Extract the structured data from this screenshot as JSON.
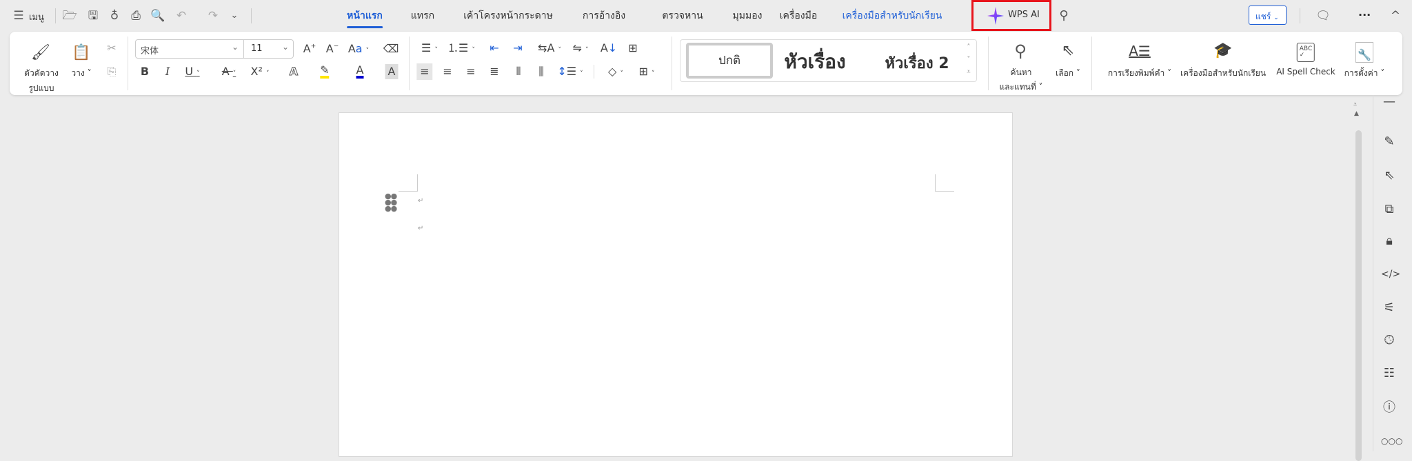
{
  "topbar": {
    "menu_label": "เมนู",
    "tabs": [
      "หน้าแรก",
      "แทรก",
      "เค้าโครงหน้ากระดาษ",
      "การอ้างอิง",
      "ตรวจหาน",
      "มุมมอง",
      "เครื่องมือ",
      "เครื่องมือสำหรับนักเรียน"
    ],
    "wps_ai_label": "WPS AI",
    "share_label": "แชร์",
    "more_label": "···"
  },
  "ribbon": {
    "format_painter": [
      "ตัวคัดวาง",
      "รูปแบบ"
    ],
    "paste": "วาง",
    "font_name": "宋体",
    "font_size": "11",
    "styles": {
      "normal": "ปกติ",
      "heading1": "หัวเรื่อง",
      "heading2": "หัวเรื่อง 2"
    },
    "find": [
      "ค้นหา",
      "และแทนที่"
    ],
    "select": "เลือก",
    "typesetting": "การเรียงพิมพ์คำ",
    "student_tools": "เครื่องมือสำหรับนักเรียน",
    "spell_check": "AI Spell Check",
    "settings": "การตั้งค่า"
  },
  "colors": {
    "accent": "#1f5fd6",
    "highlight": "#ffe600",
    "font_color": "#0000d0",
    "ai_box": "#e8141c"
  }
}
